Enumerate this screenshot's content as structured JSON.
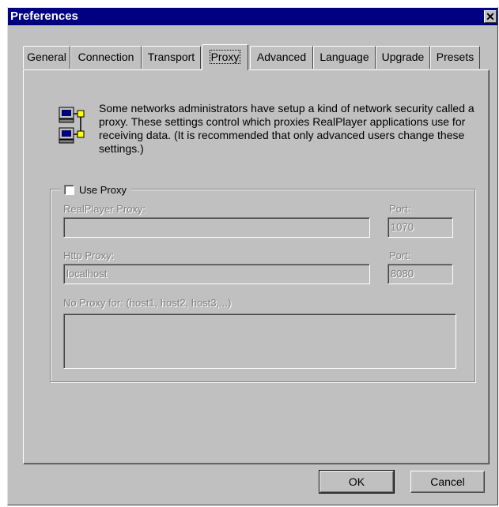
{
  "window": {
    "title": "Preferences",
    "close_glyph": "✕"
  },
  "tabs": [
    {
      "label": "General",
      "active": false
    },
    {
      "label": "Connection",
      "active": false
    },
    {
      "label": "Transport",
      "active": false
    },
    {
      "label": "Proxy",
      "active": true
    },
    {
      "label": "Advanced",
      "active": false
    },
    {
      "label": "Language",
      "active": false
    },
    {
      "label": "Upgrade",
      "active": false
    },
    {
      "label": "Presets",
      "active": false
    }
  ],
  "proxy_tab": {
    "icon": "network-computers-icon",
    "description": "Some networks administrators have setup a kind of network security called a proxy. These settings control which proxies RealPlayer applications use for receiving data. (It is recommended that only advanced users change these settings.)",
    "use_proxy": {
      "label": "Use Proxy",
      "checked": false
    },
    "realplayer_proxy": {
      "label": "RealPlayer Proxy:",
      "value": "",
      "enabled": false
    },
    "realplayer_port": {
      "label": "Port:",
      "value": "1070",
      "enabled": false
    },
    "http_proxy": {
      "label": "Http Proxy:",
      "value": "localhost",
      "enabled": false
    },
    "http_port": {
      "label": "Port:",
      "value": "8080",
      "enabled": false
    },
    "no_proxy": {
      "label": "No Proxy for: (host1, host2, host3,...)",
      "value": "",
      "enabled": false
    }
  },
  "buttons": {
    "ok": "OK",
    "cancel": "Cancel"
  }
}
